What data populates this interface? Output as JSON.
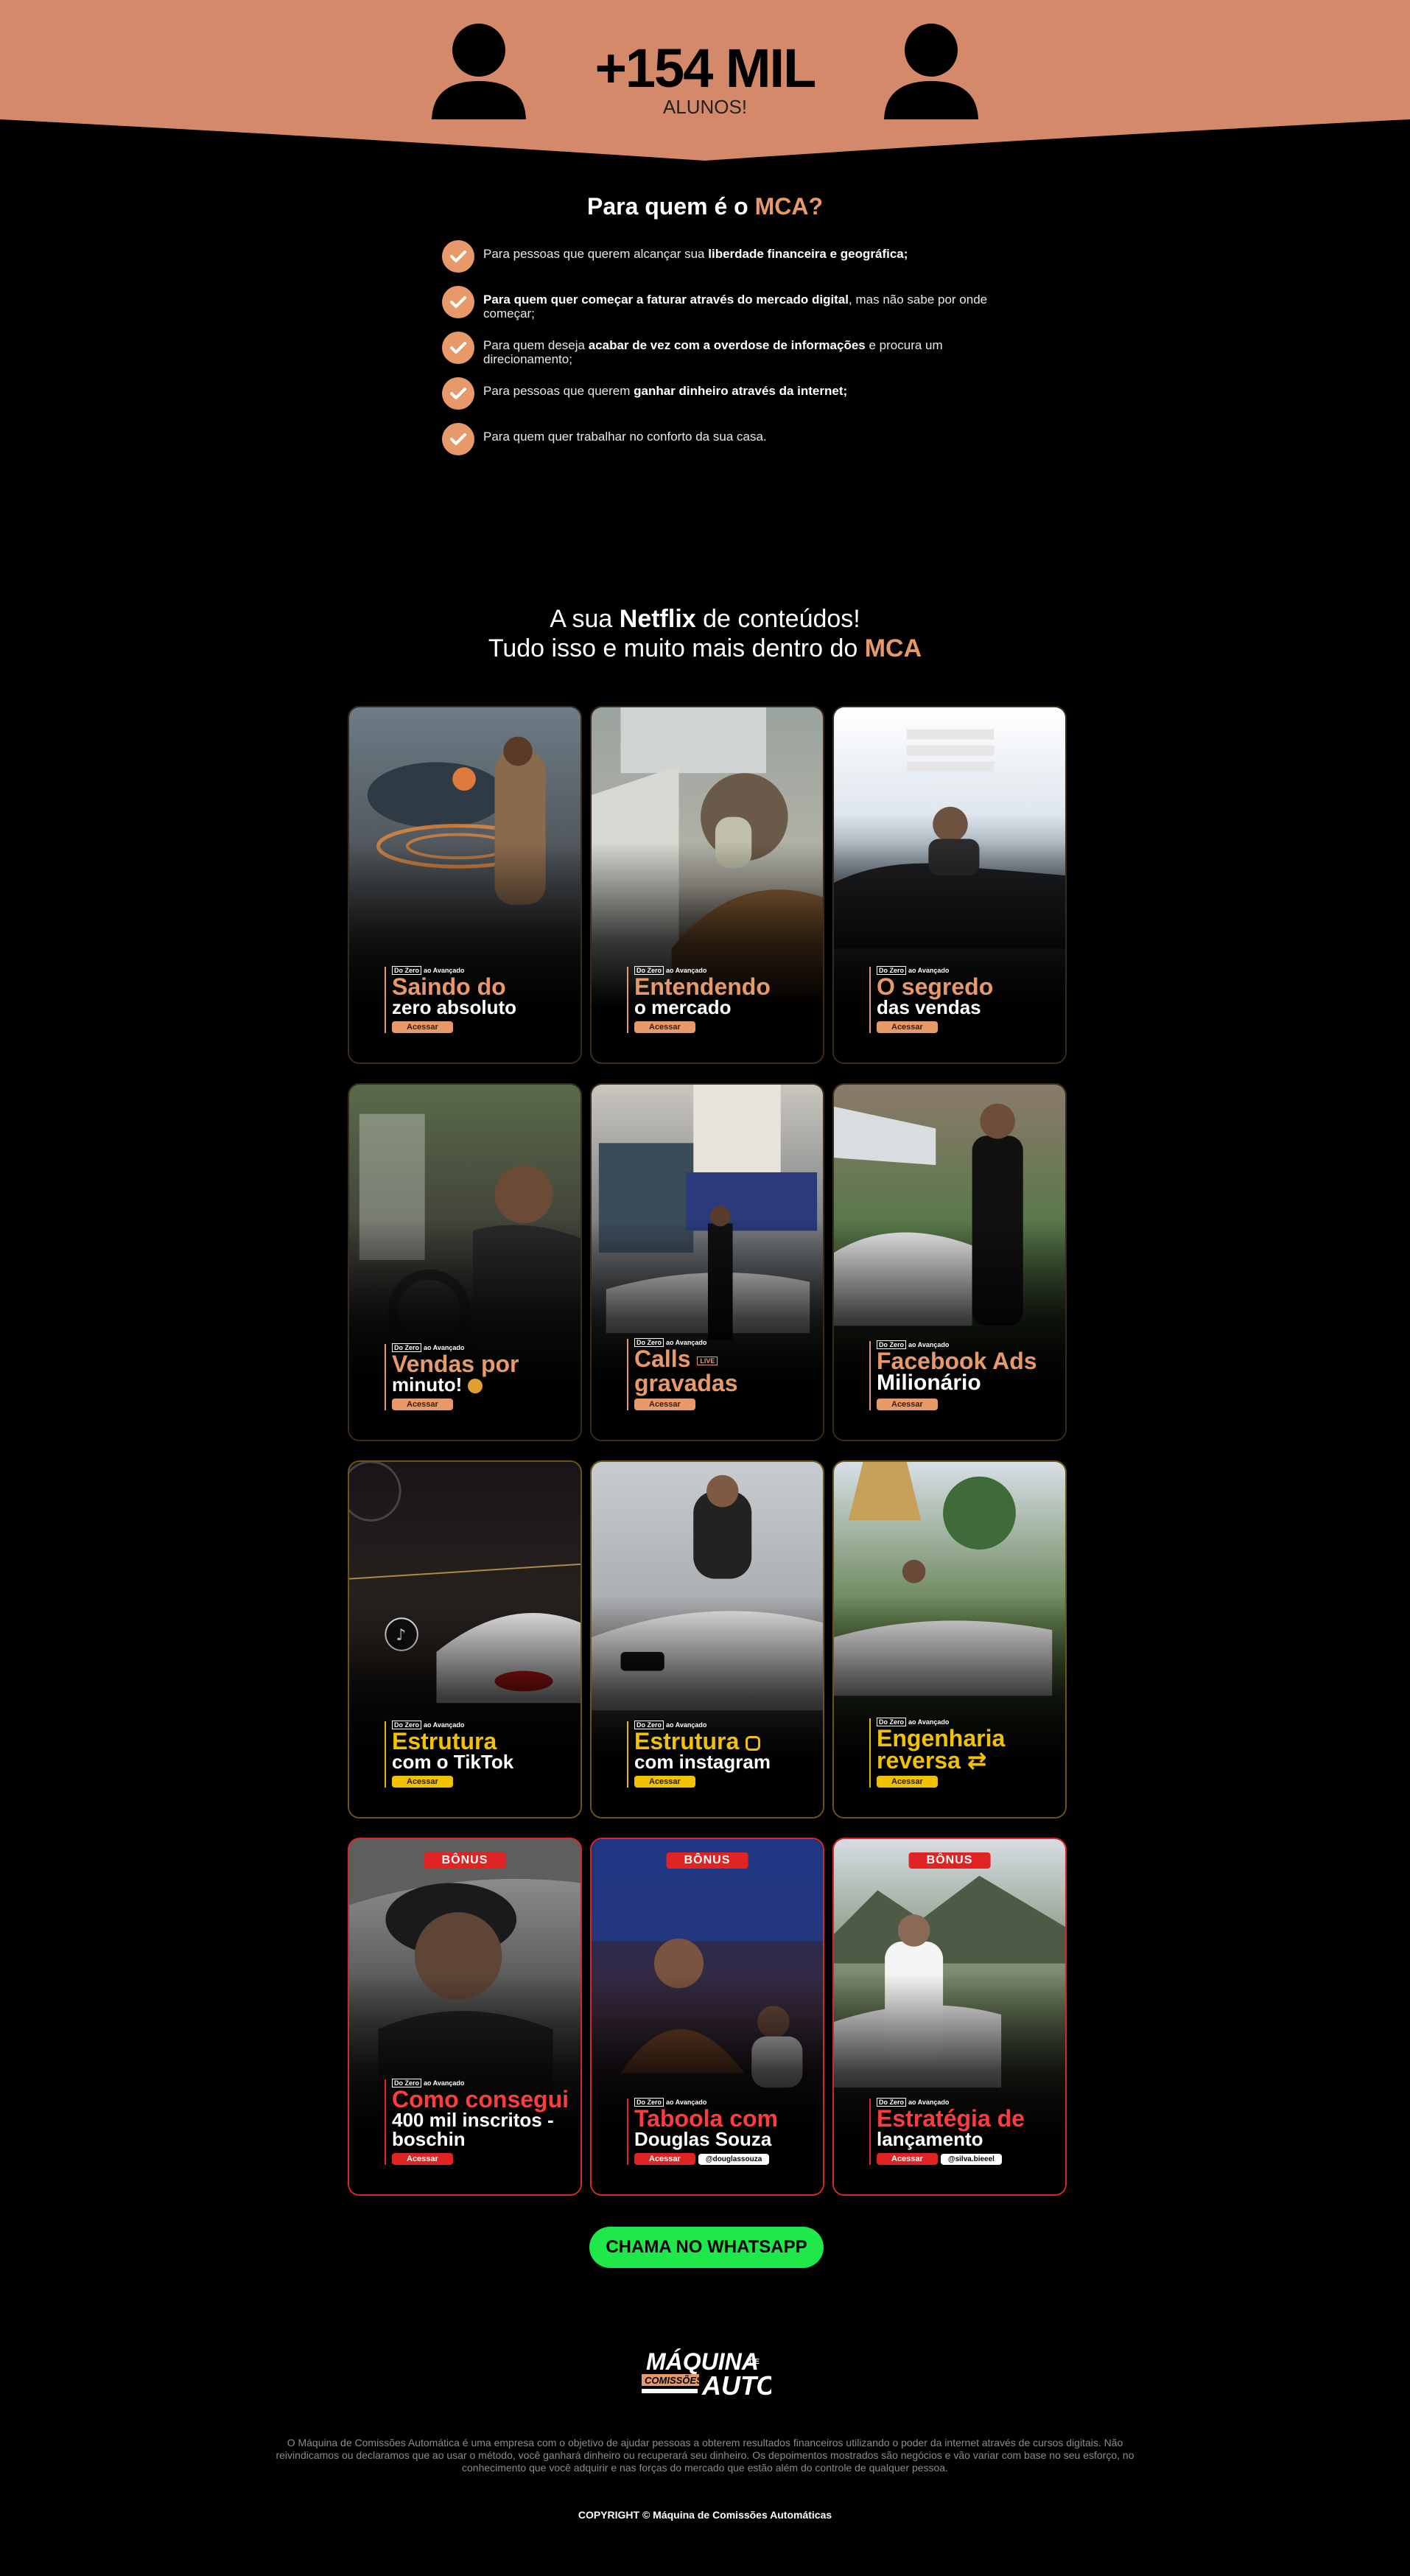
{
  "banner": {
    "stat_number": "+154 MIL",
    "stat_label": "ALUNOS!",
    "background_color": "#d4896a",
    "left_icon": "person-icon",
    "right_icon": "person-icon"
  },
  "audience": {
    "title_prefix": "Para quem é o ",
    "title_accent": "MCA?",
    "items": [
      {
        "pre": "Para pessoas que querem alcançar sua ",
        "bold": "liberdade financeira e geográfica;",
        "post": ""
      },
      {
        "pre": "",
        "bold": "Para quem quer começar a faturar através do mercado digital",
        "post": ", mas não sabe por onde começar;"
      },
      {
        "pre": "Para quem deseja ",
        "bold": "acabar de vez com a overdose de informações",
        "post": " e procura um direcionamento;"
      },
      {
        "pre": "Para pessoas que querem ",
        "bold": "ganhar dinheiro através da internet;",
        "post": ""
      },
      {
        "pre": "Para quem quer trabalhar no conforto da sua casa.",
        "bold": "",
        "post": ""
      }
    ]
  },
  "netflix": {
    "line1_pre": "A sua ",
    "line1_bold": "Netflix",
    "line1_post": " de conteúdos!",
    "line2_pre": "Tudo isso e muito mais dentro do ",
    "line2_accent": "MCA"
  },
  "cards": [
    {
      "theme": "orange",
      "tag": "Do Zero ao Avançado",
      "line1": "Saindo do",
      "line2": "zero absoluto",
      "button": "Acessar"
    },
    {
      "theme": "orange",
      "tag": "Do Zero ao Avançado",
      "line1": "Entendendo",
      "line2": "o mercado",
      "button": "Acessar"
    },
    {
      "theme": "orange",
      "tag": "Do Zero ao Avançado",
      "line1": "O segredo",
      "line2": "das vendas",
      "button": "Acessar"
    },
    {
      "theme": "orange",
      "tag": "Do Zero ao Avançado",
      "line1": "Vendas por",
      "line2": "minuto!",
      "button": "Acessar"
    },
    {
      "theme": "orange",
      "tag": "Do Zero ao Avançado",
      "line1": "Calls",
      "line2": "gravadas",
      "button": "Acessar",
      "live": "LIVE"
    },
    {
      "theme": "orange",
      "tag": "Do Zero ao Avançado",
      "line1": "Facebook Ads",
      "line2": "Milionário",
      "button": "Acessar"
    },
    {
      "theme": "gold",
      "tag": "Do Zero ao Avançado",
      "line1": "Estrutura",
      "line2": "com o TikTok",
      "button": "Acessar"
    },
    {
      "theme": "gold",
      "tag": "Do Zero ao Avançado",
      "line1": "Estrutura",
      "line2": "com instagram",
      "button": "Acessar"
    },
    {
      "theme": "gold",
      "tag": "Do Zero ao Avançado",
      "line1": "Engenharia",
      "line2": "reversa",
      "button": "Acessar"
    },
    {
      "theme": "red",
      "badge": "BÔNUS",
      "tag": "Do Zero ao Avançado",
      "line1": "Como consegui",
      "line2": "400 mil inscritos - boschin",
      "button": "Acessar"
    },
    {
      "theme": "red",
      "badge": "BÔNUS",
      "tag": "Do Zero ao Avançado",
      "line1": "Taboola com",
      "line2": "Douglas Souza",
      "button": "Acessar",
      "handle": "@douglassouza"
    },
    {
      "theme": "red",
      "badge": "BÔNUS",
      "tag": "Do Zero ao Avançado",
      "line1": "Estratégia de",
      "line2": "lançamento",
      "button": "Acessar",
      "handle": "@silva.bieeel"
    }
  ],
  "cta": {
    "label": "CHAMA NO WHATSAPP",
    "color": "#1ee84a"
  },
  "footer": {
    "logo_line1": "MÁQUINA",
    "logo_line2": "COMISSÕES",
    "logo_line3": "AUTO",
    "logo_de": "DE",
    "disclaimer": "O Máquina de Comissões Automática é uma empresa com o objetivo de ajudar pessoas a obterem resultados financeiros utilizando o poder da internet através de cursos digitais. Não reivindicamos ou declaramos que ao usar o método, você ganhará dinheiro ou recuperará seu dinheiro. Os depoimentos mostrados são negócios e vão variar com base no seu esforço, no conhecimento que você adquirir e nas forças do mercado que estão além do controle de qualquer pessoa.",
    "copyright": "COPYRIGHT © Máquina de Comissões Automáticas"
  },
  "colors": {
    "accent": "#e7996a",
    "gold": "#f2c200",
    "red": "#e02424",
    "green": "#1ee84a"
  }
}
